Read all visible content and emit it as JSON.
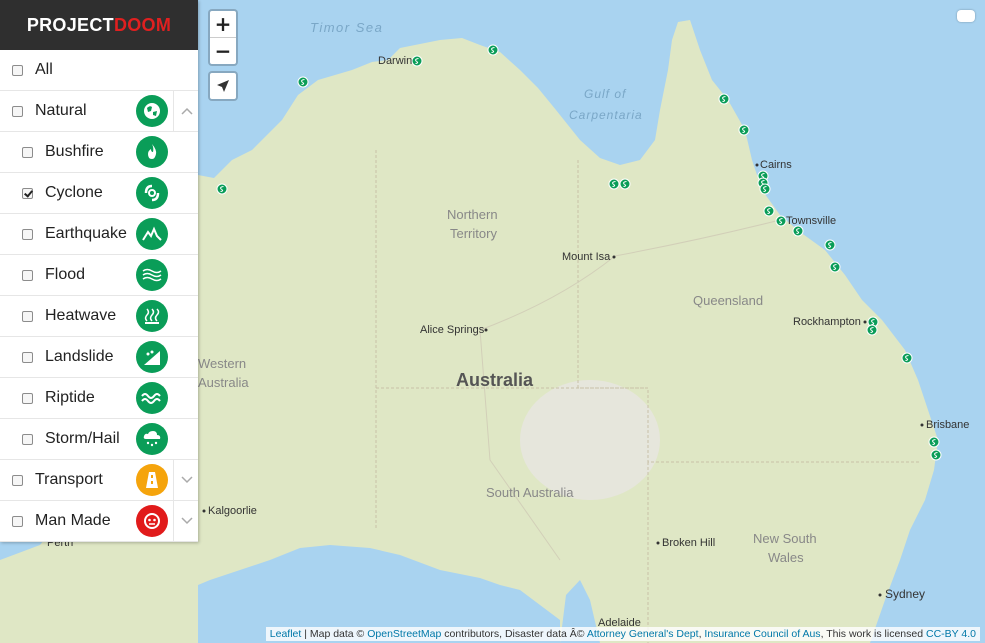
{
  "brand": {
    "part1": "PROJECT",
    "part2": "DOOM"
  },
  "categories": [
    {
      "label": "All",
      "checked": false,
      "level": 0
    },
    {
      "label": "Natural",
      "checked": false,
      "level": 0,
      "icon": "globe-icon",
      "color": "#0a9d58",
      "expanded": true
    },
    {
      "label": "Bushfire",
      "checked": false,
      "level": 1,
      "icon": "fire-icon",
      "color": "#0a9d58"
    },
    {
      "label": "Cyclone",
      "checked": true,
      "level": 1,
      "icon": "cyclone-icon",
      "color": "#0a9d58"
    },
    {
      "label": "Earthquake",
      "checked": false,
      "level": 1,
      "icon": "earthquake-icon",
      "color": "#0a9d58"
    },
    {
      "label": "Flood",
      "checked": false,
      "level": 1,
      "icon": "flood-icon",
      "color": "#0a9d58"
    },
    {
      "label": "Heatwave",
      "checked": false,
      "level": 1,
      "icon": "heatwave-icon",
      "color": "#0a9d58"
    },
    {
      "label": "Landslide",
      "checked": false,
      "level": 1,
      "icon": "landslide-icon",
      "color": "#0a9d58"
    },
    {
      "label": "Riptide",
      "checked": false,
      "level": 1,
      "icon": "riptide-icon",
      "color": "#0a9d58"
    },
    {
      "label": "Storm/Hail",
      "checked": false,
      "level": 1,
      "icon": "storm-icon",
      "color": "#0a9d58"
    },
    {
      "label": "Transport",
      "checked": false,
      "level": 0,
      "icon": "transport-icon",
      "color": "#f5a40c",
      "expanded": false
    },
    {
      "label": "Man Made",
      "checked": false,
      "level": 0,
      "icon": "manmade-icon",
      "color": "#e11b1b",
      "expanded": false
    }
  ],
  "map_labels": {
    "timor_sea": "Timor Sea",
    "gulf": "Gulf of",
    "carpentaria": "Carpentaria",
    "darwin": "Darwin",
    "northern": "Northern",
    "territory": "Territory",
    "mount_isa": "Mount Isa",
    "cairns": "Cairns",
    "townsville": "Townsville",
    "queensland": "Queensland",
    "alice_springs": "Alice Springs",
    "rockhampton": "Rockhampton",
    "western": "Western",
    "wa_australia": "Australia",
    "australia": "Australia",
    "brisbane": "Brisbane",
    "south_australia": "South Australia",
    "kalgoorlie": "Kalgoorlie",
    "perth": "Perth",
    "broken_hill": "Broken Hill",
    "new_south": "New South",
    "wales": "Wales",
    "sydney": "Sydney",
    "adelaide": "Adelaide"
  },
  "zoom": {
    "in": "+",
    "out": "−"
  },
  "attribution": {
    "leaflet": "Leaflet",
    "sep1": " | Map data © ",
    "osm": "OpenStreetMap",
    "sep2": " contributors, Disaster data Â© ",
    "agd": "Attorney General's Dept",
    "sep3": ", ",
    "ica": "Insurance Council of Aus",
    "sep4": ", This work is licensed ",
    "license": "CC-BY 4.0"
  },
  "colors": {
    "marker": "#0a9d58",
    "water": "#a9d3f0",
    "land": "#dde6c3"
  },
  "markers_icon": "cyclone-marker-icon"
}
